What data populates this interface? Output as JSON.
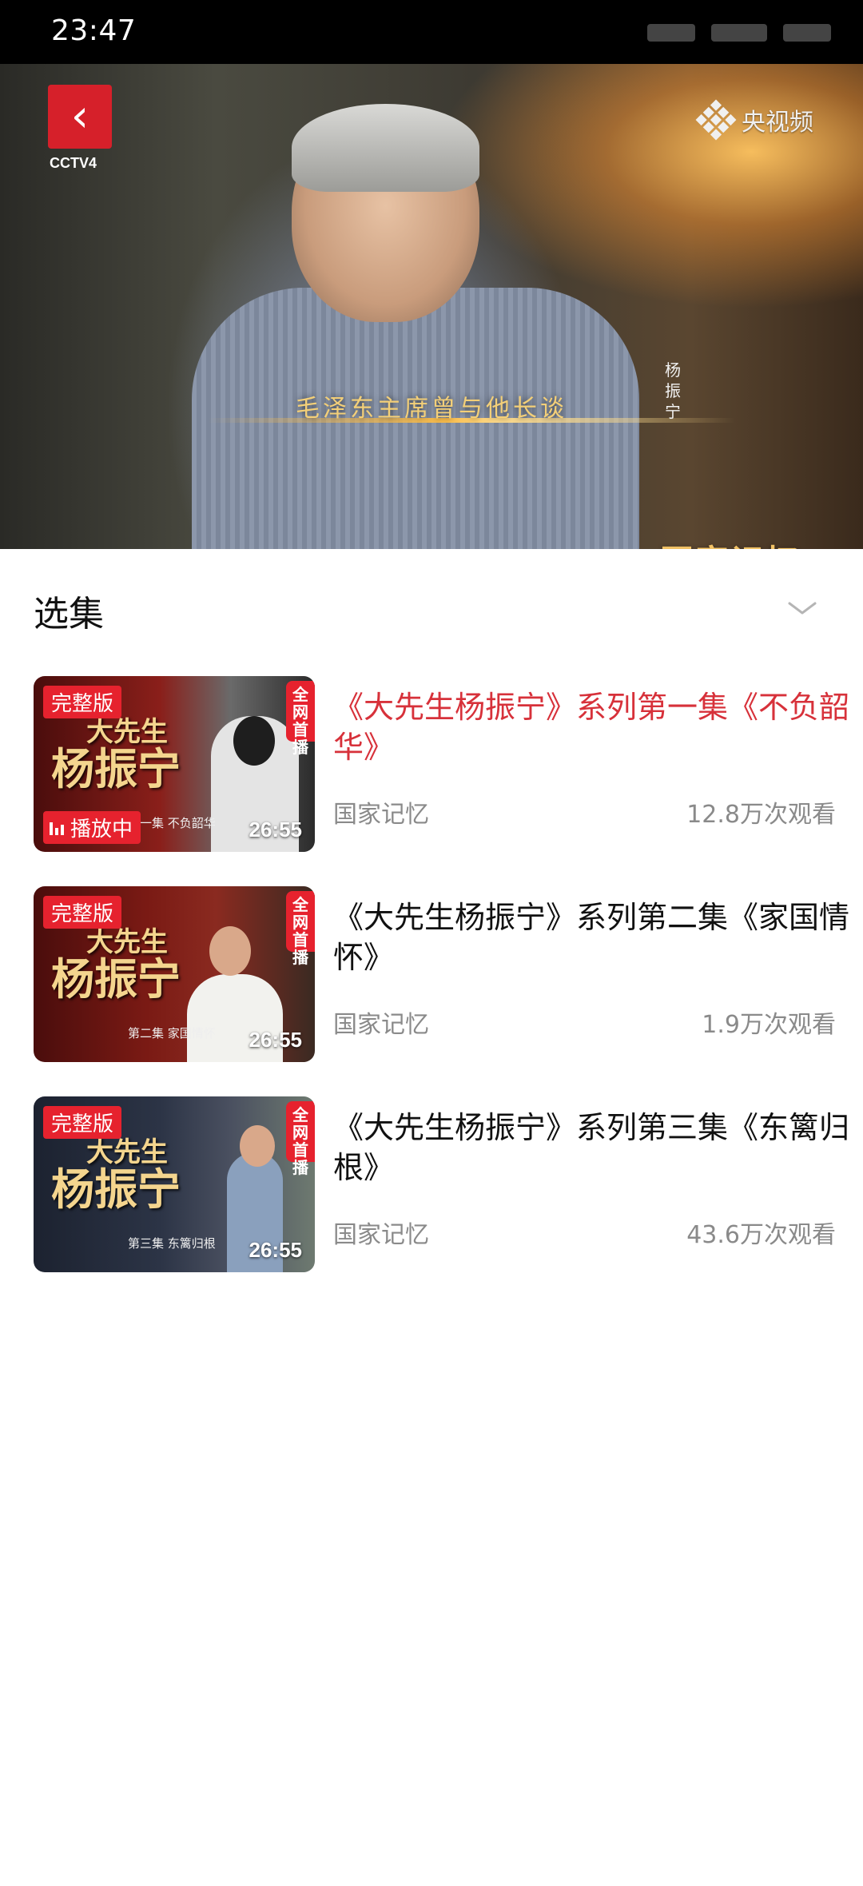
{
  "status_bar": {
    "time": "23:47"
  },
  "player": {
    "channel_label": "CCTV4",
    "watermark": "央视频",
    "caption": "毛泽东主席曾与他长谈",
    "person_name": "杨振宁",
    "program_logo": "国家记忆"
  },
  "episodes_section": {
    "title": "选集"
  },
  "episodes": [
    {
      "title": "《大先生杨振宁》系列第一集《不负韶华》",
      "source": "国家记忆",
      "views": "12.8万次观看",
      "duration": "26:55",
      "badge": "完整版",
      "premiere_badge": "全网首播",
      "thumb_title": "大先生",
      "thumb_title2": "杨振宁",
      "thumb_sub": "第一集  不负韶华",
      "playing": true,
      "playing_label": "播放中"
    },
    {
      "title": "《大先生杨振宁》系列第二集《家国情怀》",
      "source": "国家记忆",
      "views": "1.9万次观看",
      "duration": "26:55",
      "badge": "完整版",
      "premiere_badge": "全网首播",
      "thumb_title": "大先生",
      "thumb_title2": "杨振宁",
      "thumb_sub": "第二集  家国情怀",
      "playing": false
    },
    {
      "title": "《大先生杨振宁》系列第三集《东篱归根》",
      "source": "国家记忆",
      "views": "43.6万次观看",
      "duration": "26:55",
      "badge": "完整版",
      "premiere_badge": "全网首播",
      "thumb_title": "大先生",
      "thumb_title2": "杨振宁",
      "thumb_sub": "第三集  东篱归根",
      "playing": false
    }
  ],
  "colors": {
    "accent": "#e6222e",
    "active_title": "#d7313a",
    "muted": "#8a8a8a"
  },
  "icons": {
    "back": "back-chevron-icon",
    "expand": "chevron-down-icon",
    "playing": "equalizer-icon"
  }
}
